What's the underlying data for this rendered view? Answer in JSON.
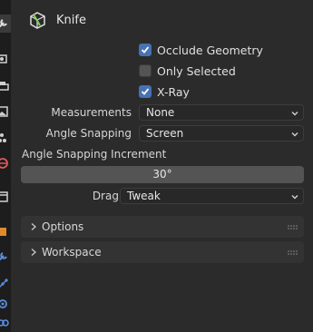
{
  "tool": {
    "name": "Knife"
  },
  "options": {
    "occlude_geometry": {
      "label": "Occlude Geometry",
      "checked": true
    },
    "only_selected": {
      "label": "Only Selected",
      "checked": false
    },
    "x_ray": {
      "label": "X-Ray",
      "checked": true
    }
  },
  "measurements": {
    "label": "Measurements",
    "value": "None"
  },
  "angle_snapping": {
    "label": "Angle Snapping",
    "value": "Screen"
  },
  "angle_snapping_increment": {
    "label": "Angle Snapping Increment",
    "value": "30°"
  },
  "drag": {
    "label": "Drag:",
    "value": "Tweak"
  },
  "panels": [
    {
      "title": "Options",
      "expanded": false
    },
    {
      "title": "Workspace",
      "expanded": false
    }
  ],
  "tabs": [
    "tool-icon",
    "render-icon",
    "output-icon",
    "view-layer-icon",
    "scene-icon",
    "world-icon",
    "collection-icon",
    "object-icon",
    "modifier-icon",
    "particles-icon",
    "physics-icon",
    "constraints-icon"
  ],
  "colors": {
    "accent": "#4772b3",
    "panel_bg": "#2b2b2b",
    "strip_bg": "#1d1d1d"
  }
}
